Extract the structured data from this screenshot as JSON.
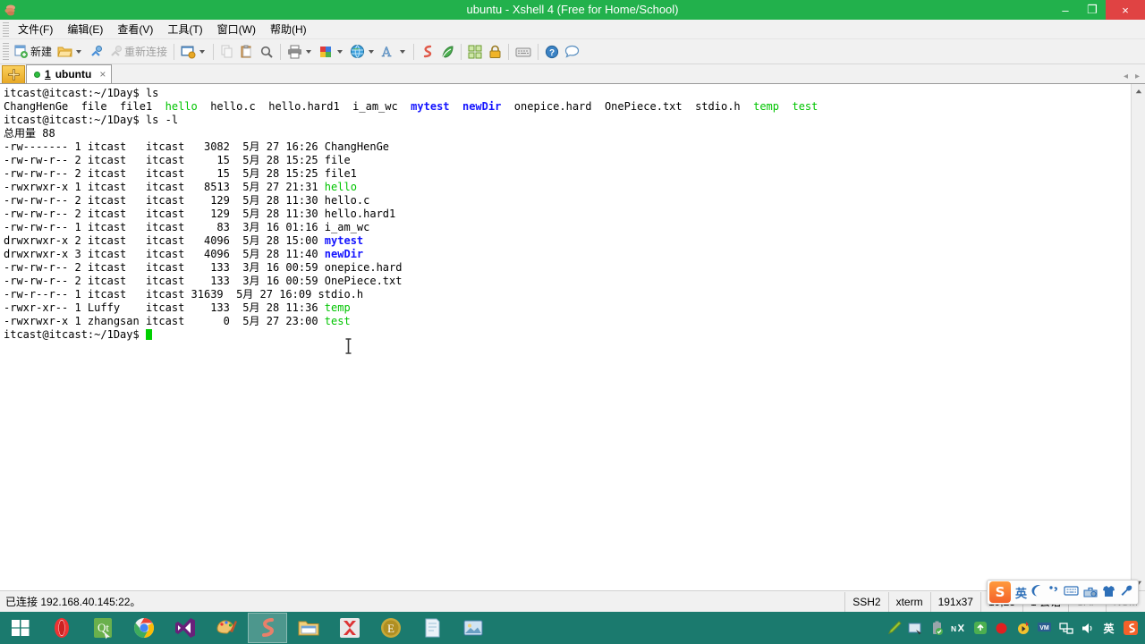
{
  "window": {
    "title": "ubuntu - Xshell 4 (Free for Home/School)",
    "app_icon": "xshell-icon",
    "minimize_label": "–",
    "maximize_label": "❐",
    "close_label": "×",
    "titlebar_color": "#22b14c"
  },
  "menubar": {
    "items": [
      {
        "label": "文件(F)",
        "name": "menu-file"
      },
      {
        "label": "编辑(E)",
        "name": "menu-edit"
      },
      {
        "label": "查看(V)",
        "name": "menu-view"
      },
      {
        "label": "工具(T)",
        "name": "menu-tools"
      },
      {
        "label": "窗口(W)",
        "name": "menu-window"
      },
      {
        "label": "帮助(H)",
        "name": "menu-help"
      }
    ]
  },
  "toolbar": {
    "new_label": "新建",
    "reconnect_label": "重新连接",
    "icons": [
      "new-session-icon",
      "open-folder-icon",
      "connect-icon",
      "disconnect-icon",
      "reconnect-icon",
      "properties-icon",
      "copy-icon",
      "paste-icon",
      "find-icon",
      "print-icon",
      "color-scheme-icon",
      "globe-icon",
      "font-icon",
      "xshell-script-icon",
      "xftp-icon",
      "layout-icon",
      "lock-icon",
      "keyboard-icon",
      "help-icon",
      "chat-icon"
    ]
  },
  "tabs": {
    "new_tab_icon": "new-tab-icon",
    "items": [
      {
        "index": "1",
        "label": "ubuntu",
        "status": "connected",
        "close_label": "×"
      }
    ]
  },
  "terminal": {
    "lines": [
      {
        "segments": [
          {
            "text": "itcast@itcast:~/1Day$ ls",
            "color": "default"
          }
        ]
      },
      {
        "segments": [
          {
            "text": "ChangHenGe  file  file1  ",
            "color": "default"
          },
          {
            "text": "hello",
            "color": "exec"
          },
          {
            "text": "  hello.c  hello.hard1  i_am_wc  ",
            "color": "default"
          },
          {
            "text": "mytest",
            "color": "dir"
          },
          {
            "text": "  ",
            "color": "default"
          },
          {
            "text": "newDir",
            "color": "dir"
          },
          {
            "text": "  onepice.hard  OnePiece.txt  stdio.h  ",
            "color": "default"
          },
          {
            "text": "temp",
            "color": "exec"
          },
          {
            "text": "  ",
            "color": "default"
          },
          {
            "text": "test",
            "color": "exec"
          }
        ]
      },
      {
        "segments": [
          {
            "text": "itcast@itcast:~/1Day$ ls -l",
            "color": "default"
          }
        ]
      },
      {
        "segments": [
          {
            "text": "总用量 88",
            "color": "default"
          }
        ]
      },
      {
        "segments": [
          {
            "text": "-rw------- 1 itcast   itcast   3082  5月 27 16:26 ChangHenGe",
            "color": "default"
          }
        ]
      },
      {
        "segments": [
          {
            "text": "-rw-rw-r-- 2 itcast   itcast     15  5月 28 15:25 file",
            "color": "default"
          }
        ]
      },
      {
        "segments": [
          {
            "text": "-rw-rw-r-- 2 itcast   itcast     15  5月 28 15:25 file1",
            "color": "default"
          }
        ]
      },
      {
        "segments": [
          {
            "text": "-rwxrwxr-x 1 itcast   itcast   8513  5月 27 21:31 ",
            "color": "default"
          },
          {
            "text": "hello",
            "color": "exec"
          }
        ]
      },
      {
        "segments": [
          {
            "text": "-rw-rw-r-- 2 itcast   itcast    129  5月 28 11:30 hello.c",
            "color": "default"
          }
        ]
      },
      {
        "segments": [
          {
            "text": "-rw-rw-r-- 2 itcast   itcast    129  5月 28 11:30 hello.hard1",
            "color": "default"
          }
        ]
      },
      {
        "segments": [
          {
            "text": "-rw-rw-r-- 1 itcast   itcast     83  3月 16 01:16 i_am_wc",
            "color": "default"
          }
        ]
      },
      {
        "segments": [
          {
            "text": "drwxrwxr-x 2 itcast   itcast   4096  5月 28 15:00 ",
            "color": "default"
          },
          {
            "text": "mytest",
            "color": "dir"
          }
        ]
      },
      {
        "segments": [
          {
            "text": "drwxrwxr-x 3 itcast   itcast   4096  5月 28 11:40 ",
            "color": "default"
          },
          {
            "text": "newDir",
            "color": "dir"
          }
        ]
      },
      {
        "segments": [
          {
            "text": "-rw-rw-r-- 2 itcast   itcast    133  3月 16 00:59 onepice.hard",
            "color": "default"
          }
        ]
      },
      {
        "segments": [
          {
            "text": "-rw-rw-r-- 2 itcast   itcast    133  3月 16 00:59 OnePiece.txt",
            "color": "default"
          }
        ]
      },
      {
        "segments": [
          {
            "text": "-rw-r--r-- 1 itcast   itcast 31639  5月 27 16:09 stdio.h",
            "color": "default"
          }
        ]
      },
      {
        "segments": [
          {
            "text": "-rwxr-xr-- 1 Luffy    itcast    133  5月 28 11:36 ",
            "color": "default"
          },
          {
            "text": "temp",
            "color": "exec"
          }
        ]
      },
      {
        "segments": [
          {
            "text": "-rwxrwxr-x 1 zhangsan itcast      0  5月 27 23:00 ",
            "color": "default"
          },
          {
            "text": "test",
            "color": "exec"
          }
        ]
      },
      {
        "segments": [
          {
            "text": "itcast@itcast:~/1Day$ ",
            "color": "default"
          },
          {
            "text": "",
            "color": "cursor"
          }
        ]
      }
    ],
    "colors": {
      "background": "#ffffff",
      "foreground": "#000000",
      "executable": "#00c400",
      "directory": "#1414ff",
      "cursor": "#00d000"
    }
  },
  "statusbar": {
    "connection": "已连接 192.168.40.145:22。",
    "protocol": "SSH2",
    "term_type": "xterm",
    "size": "191x37",
    "cursor_pos": "19,23",
    "sessions": "1 会话",
    "caps": "CAP",
    "num": "NUM"
  },
  "ime": {
    "logo": "S",
    "mode_label": "英",
    "items": [
      "moon-icon",
      "comma-icon",
      "keyboard-icon",
      "toolbox-icon",
      "skin-icon",
      "wrench-icon"
    ]
  },
  "taskbar": {
    "start_icon": "windows-start-icon",
    "apps": [
      {
        "name": "opera-icon",
        "active": false
      },
      {
        "name": "qt-creator-icon",
        "active": false
      },
      {
        "name": "chrome-icon",
        "active": false
      },
      {
        "name": "visual-studio-icon",
        "active": false
      },
      {
        "name": "paint-icon",
        "active": false
      },
      {
        "name": "xshell-icon",
        "active": true
      },
      {
        "name": "file-explorer-icon",
        "active": false
      },
      {
        "name": "xmind-icon",
        "active": false
      },
      {
        "name": "everedit-icon",
        "active": false
      },
      {
        "name": "notepad-icon",
        "active": false
      },
      {
        "name": "picture-viewer-icon",
        "active": false
      }
    ],
    "tray": [
      "pen-icon",
      "screenshot-icon",
      "battery-icon",
      "nx-icon",
      "upload-icon",
      "record-icon",
      "media-icon",
      "vm-icon",
      "network-icon",
      "volume-icon",
      "ime-en-icon",
      "sogou-icon"
    ]
  }
}
